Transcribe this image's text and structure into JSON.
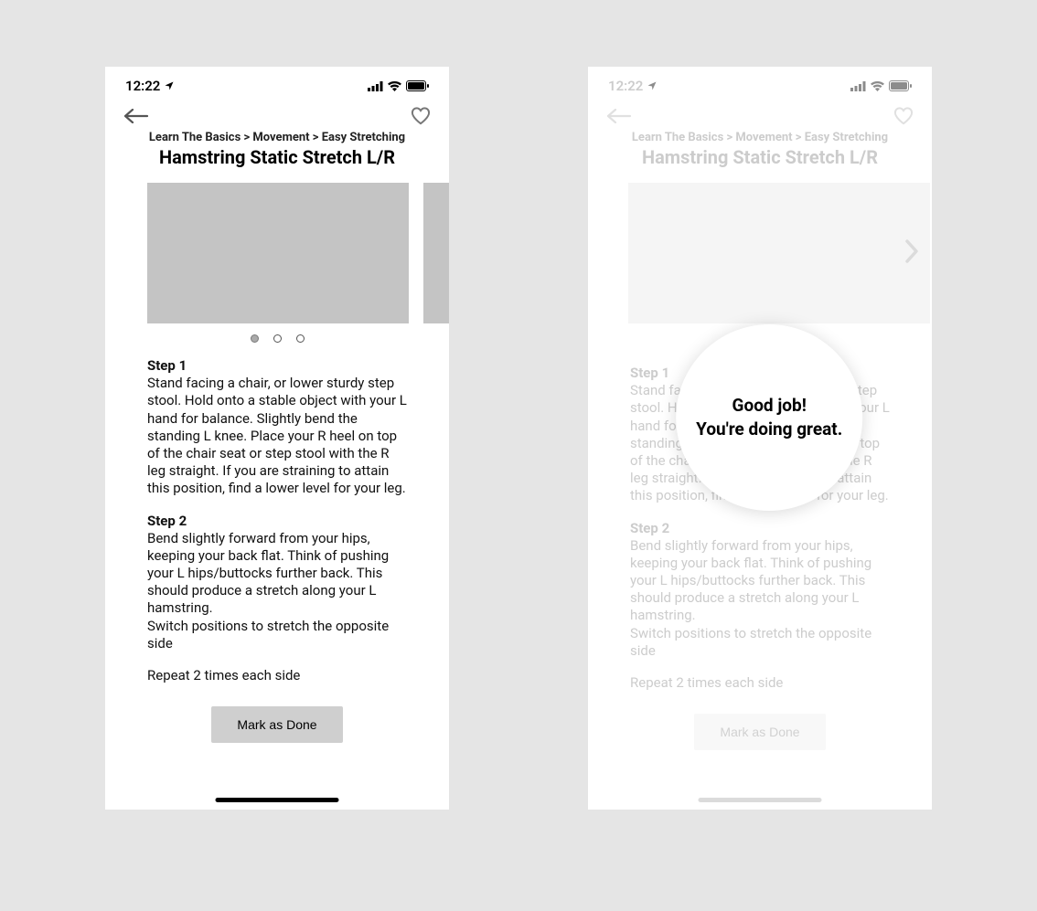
{
  "status": {
    "time": "12:22"
  },
  "breadcrumb": "Learn The Basics > Movement > Easy Stretching",
  "title": "Hamstring Static Stretch L/R",
  "steps": {
    "step1_heading": "Step 1",
    "step1_body": "Stand facing a chair, or lower sturdy step stool. Hold onto a stable object with your L hand for balance.  Slightly bend the standing L knee.  Place your R heel on top of the chair seat or step stool with the R leg straight. If you are straining to attain this position, find a lower level for your leg.",
    "step2_heading": "Step 2",
    "step2_body": "Bend slightly forward from your hips, keeping your back flat.  Think of pushing your L hips/buttocks further back. This should produce a stretch along your L hamstring.\nSwitch positions to stretch the opposite side",
    "repeat": "Repeat 2 times each side"
  },
  "button_label": "Mark as Done",
  "popup": {
    "line1": "Good job!",
    "line2": "You're doing great."
  }
}
